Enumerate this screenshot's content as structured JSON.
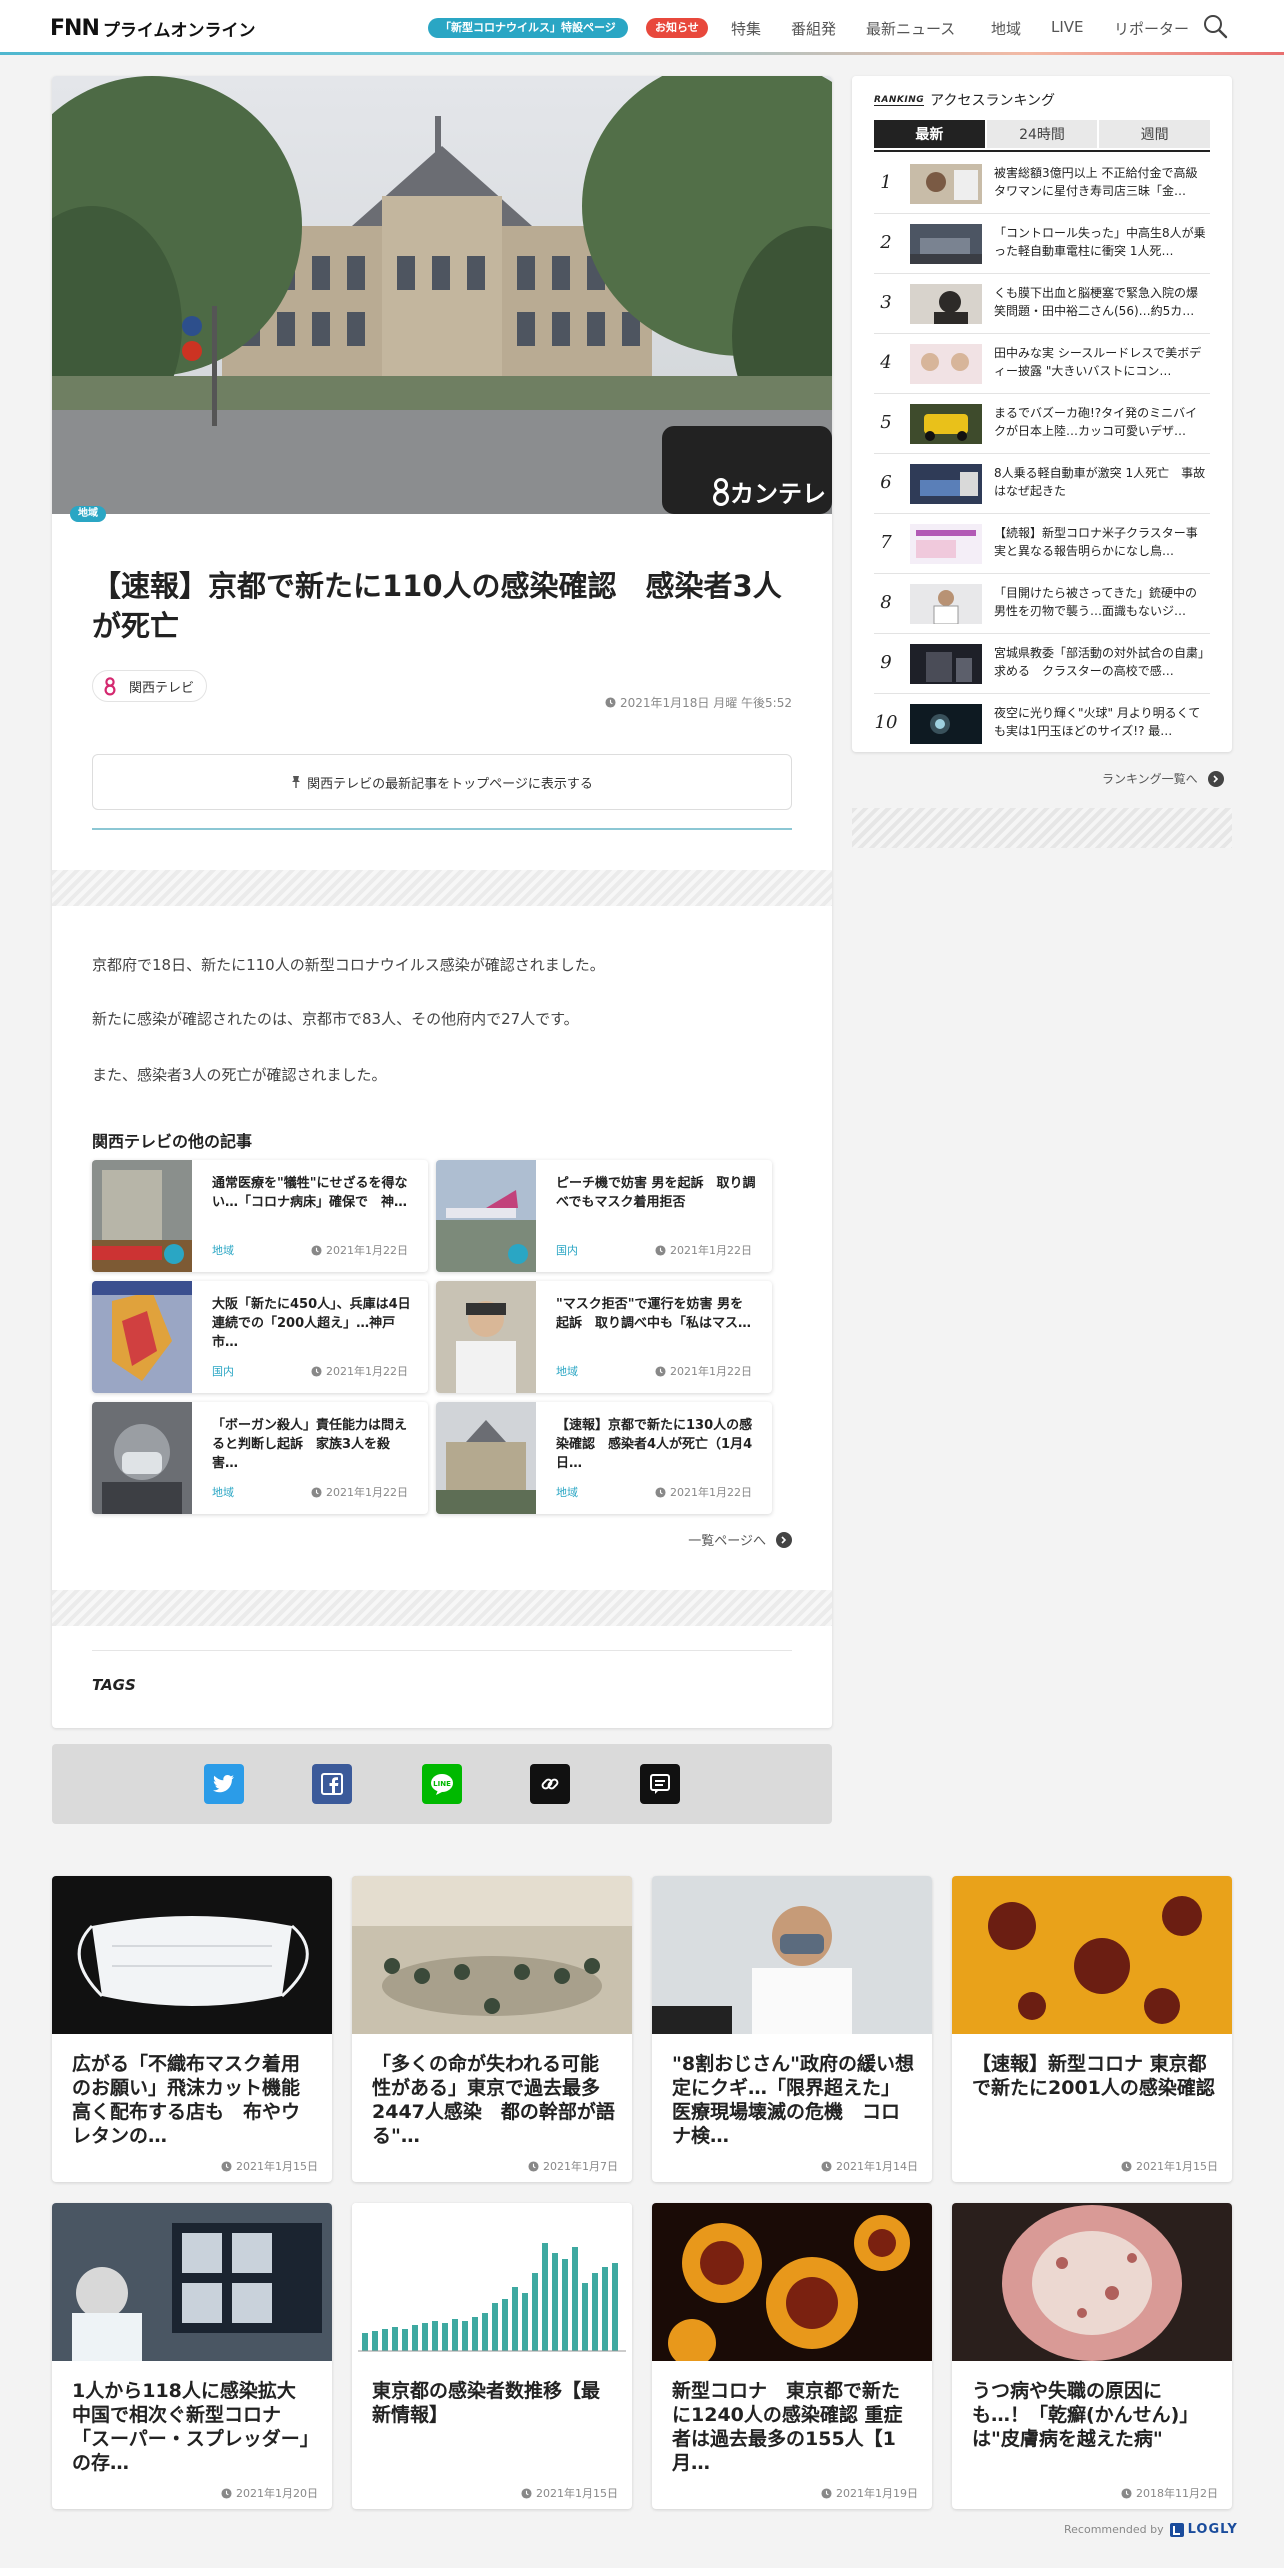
{
  "header": {
    "logo_main": "FNN",
    "logo_sub": "プライムオンライン",
    "covid_pill": "「新型コロナウイルス」特設ページ",
    "notice_pill": "お知らせ",
    "nav": [
      "特集",
      "番組発",
      "最新ニュース",
      "地域",
      "LIVE",
      "リポーター"
    ]
  },
  "article": {
    "category": "地域",
    "title": "【速報】京都で新たに110人の感染確認　感染者3人が死亡",
    "source": "関西テレビ",
    "date": "2021年1月18日 月曜 午後5:52",
    "pin_label": "関西テレビの最新記事をトップページに表示する",
    "watermark": "カンテレ",
    "paragraphs": [
      "京都府で18日、新たに110人の新型コロナウイルス感染が確認されました。",
      "新たに感染が確認されたのは、京都市で83人、その他府内で27人です。",
      "また、感染者3人の死亡が確認されました。"
    ],
    "others_heading": "関西テレビの他の記事",
    "others": [
      {
        "title": "通常医療を\"犠牲\"にせざるを得ない…「コロナ病床」確保で　神…",
        "cat": "地域",
        "date": "2021年1月22日"
      },
      {
        "title": "ピーチ機で妨害 男を起訴　取り調べでもマスク着用拒否",
        "cat": "国内",
        "date": "2021年1月22日"
      },
      {
        "title": "大阪「新たに450人」、兵庫は4日連続での「200人超え」…神戸市…",
        "cat": "国内",
        "date": "2021年1月22日"
      },
      {
        "title": "\"マスク拒否\"で運行を妨害 男を起訴　取り調べ中も「私はマス…",
        "cat": "地域",
        "date": "2021年1月22日"
      },
      {
        "title": "「ボーガン殺人」責任能力は問えると判断し起訴　家族3人を殺害…",
        "cat": "地域",
        "date": "2021年1月22日"
      },
      {
        "title": "【速報】京都で新たに130人の感染確認　感染者4人が死亡（1月4日…",
        "cat": "地域",
        "date": "2021年1月22日"
      }
    ],
    "more_label": "一覧ページへ",
    "tags_heading": "TAGS"
  },
  "ranking": {
    "badge": "RANKING",
    "heading": "アクセスランキング",
    "tabs": [
      "最新",
      "24時間",
      "週間"
    ],
    "items": [
      {
        "num": "1",
        "title": "被害総額3億円以上 不正給付金で高級タワマンに星付き寿司店三昧「金…"
      },
      {
        "num": "2",
        "title": "「コントロール失った」中高生8人が乗った軽自動車電柱に衝突 1人死…"
      },
      {
        "num": "3",
        "title": "くも膜下出血と脳梗塞で緊急入院の爆笑問題・田中裕二さん(56)…約5カ…"
      },
      {
        "num": "4",
        "title": "田中みな実 シースルードレスで美ボディー披露 \"大きいバストにコン…"
      },
      {
        "num": "5",
        "title": "まるでバズーカ砲!?タイ発のミニバイクが日本上陸…カッコ可愛いデザ…"
      },
      {
        "num": "6",
        "title": "8人乗る軽自動車が激突 1人死亡　事故はなぜ起きた"
      },
      {
        "num": "7",
        "title": "【続報】新型コロナ米子クラスター事実と異なる報告明らかになし鳥…"
      },
      {
        "num": "8",
        "title": "「目開けたら被さってきた」銃硬中の男性を刃物で襲う…面識もないジ…"
      },
      {
        "num": "9",
        "title": "宮城県教委「部活動の対外試合の自粛」求める　クラスターの高校で感…"
      },
      {
        "num": "10",
        "title": "夜空に光り輝く\"火球\" 月より明るくても実は1円玉ほどのサイズ!? 最…"
      }
    ],
    "more_label": "ランキング一覧へ"
  },
  "recommend": [
    {
      "title": "広がる「不織布マスク着用のお願い」飛沫カット機能高く配布する店も　布やウレタンの…",
      "date": "2021年1月15日"
    },
    {
      "title": "「多くの命が失われる可能性がある」東京で過去最多2447人感染　都の幹部が語る\"…",
      "date": "2021年1月7日"
    },
    {
      "title": "\"8割おじさん\"政府の緩い想定にクギ…「限界超えた」医療現場壊滅の危機　コロナ検…",
      "date": "2021年1月14日"
    },
    {
      "title": "【速報】新型コロナ 東京都で新たに2001人の感染確認",
      "date": "2021年1月15日"
    },
    {
      "title": "1人から118人に感染拡大　中国で相次ぐ新型コロナ「スーパー・スプレッダー」の存…",
      "date": "2021年1月20日"
    },
    {
      "title": "東京都の感染者数推移【最新情報】",
      "date": "2021年1月15日"
    },
    {
      "title": "新型コロナ　東京都で新たに1240人の感染確認 重症者は過去最多の155人【1月…",
      "date": "2021年1月19日"
    },
    {
      "title": "うつ病や失職の原因にも…！「乾癬(かんせん)」は\"皮膚病を越えた病\"",
      "date": "2018年11月2日"
    }
  ],
  "logly": {
    "label": "Recommended by",
    "brand": "LOGLY"
  }
}
